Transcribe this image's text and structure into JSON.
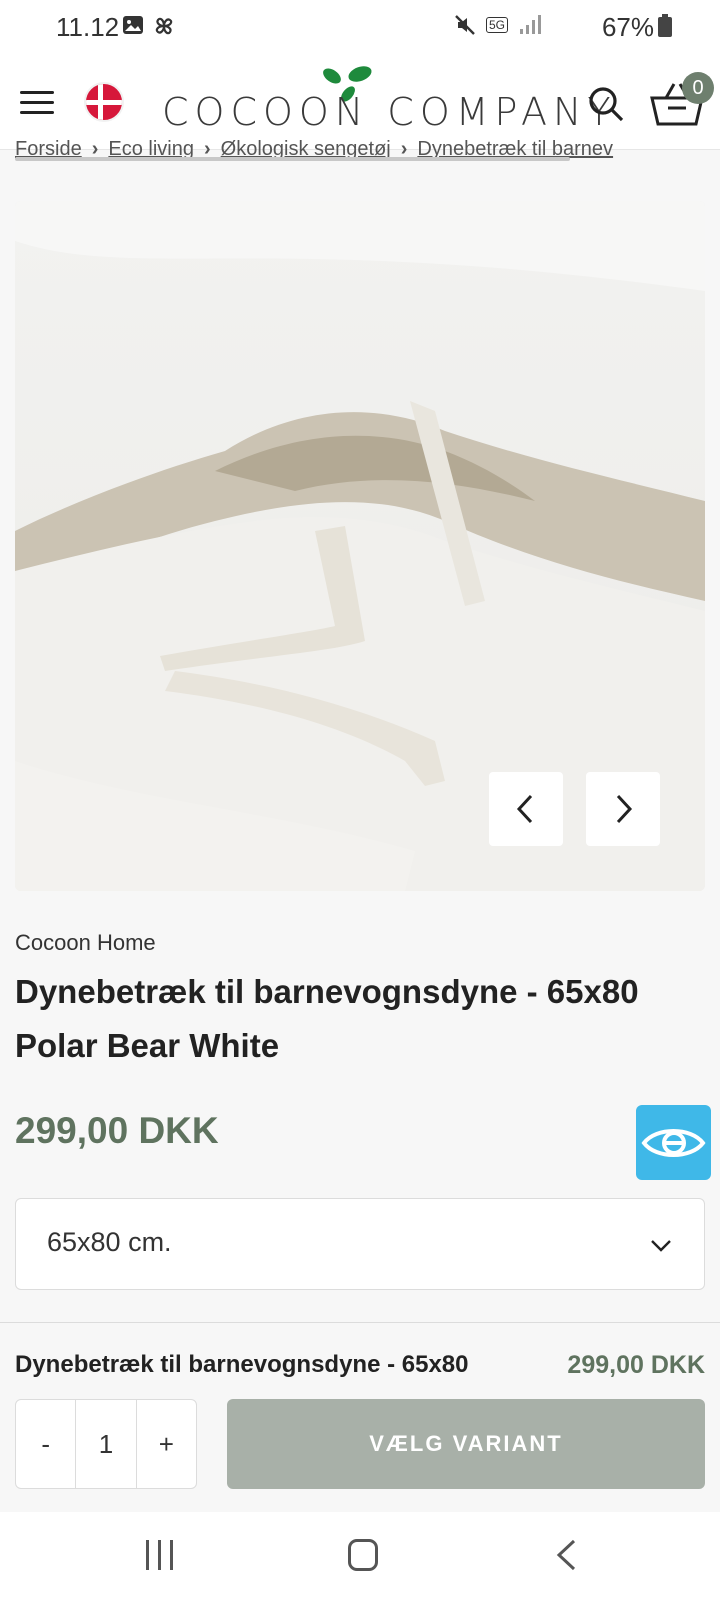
{
  "status_bar": {
    "time": "11.12",
    "network": "5G",
    "battery": "67%",
    "icons": [
      "gallery-icon",
      "pinwheel-icon",
      "mute-icon",
      "signal-icon",
      "battery-icon"
    ]
  },
  "header": {
    "logo": "COCOON COMPANY",
    "cart_count": "0",
    "icons": [
      "hamburger-menu-icon",
      "denmark-flag-icon",
      "leaf-logo-icon",
      "search-icon",
      "basket-icon"
    ]
  },
  "breadcrumb": {
    "items": [
      "Forside",
      "Eco living",
      "Økologisk sengetøj",
      "Dynebetræk til barnev"
    ],
    "separator": "›"
  },
  "product": {
    "brand": "Cocoon Home",
    "title": "Dynebetræk til barnevognsdyne - 65x80 Polar Bear White",
    "price": "299,00 DKK",
    "variant": "65x80 cm."
  },
  "sticky_bar": {
    "title": "Dynebetræk til barnevognsdyne - 65x80",
    "price": "299,00 DKK",
    "qty_minus": "-",
    "qty_value": "1",
    "qty_plus": "+",
    "cta": "VÆLG VARIANT"
  },
  "colors": {
    "accent_green": "#5f735f",
    "cta_disabled": "#a8b0a8",
    "badge_bg": "#6e7f6e",
    "e_mark_blue": "#3fb8e8",
    "flag_red": "#d6173a"
  }
}
